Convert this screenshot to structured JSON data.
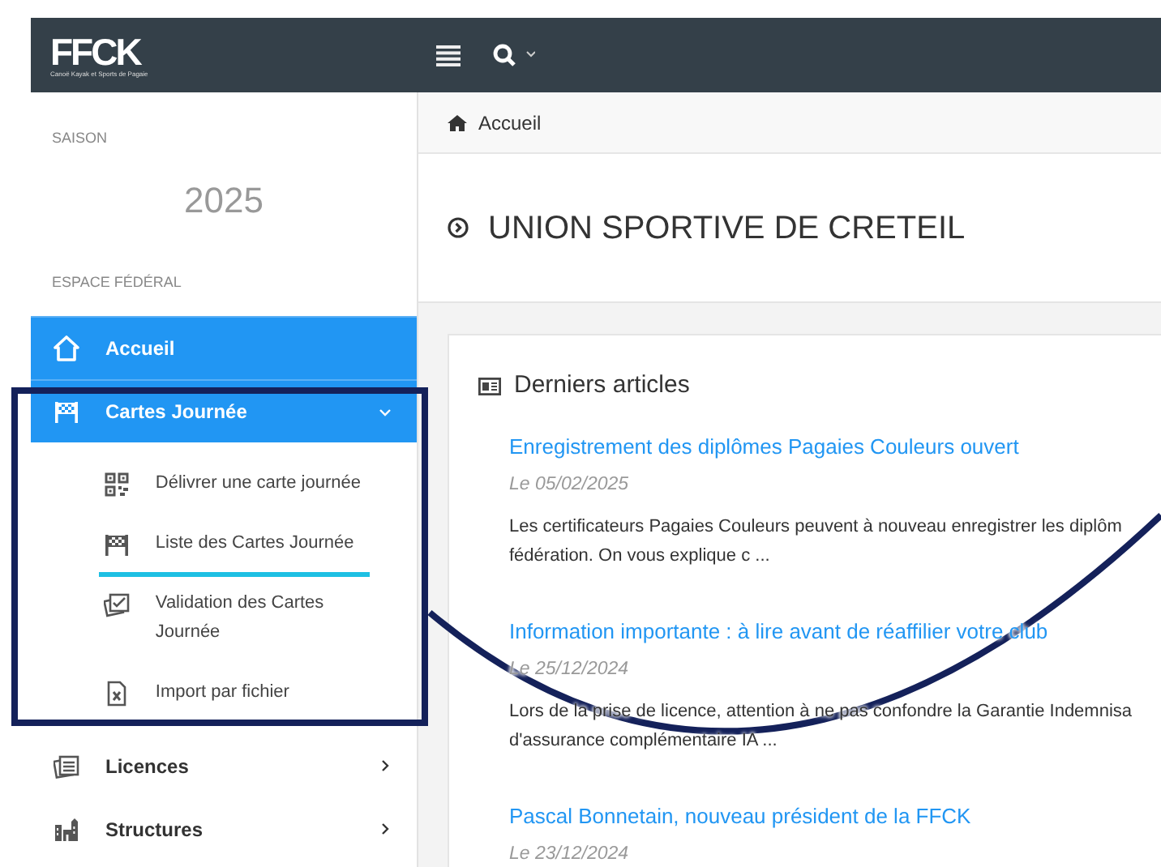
{
  "logo": {
    "text": "FFCK",
    "tagline": "Canoë Kayak et Sports de Pagaie"
  },
  "sidebar": {
    "season_label": "SAISON",
    "season": "2025",
    "section_label": "ESPACE FÉDÉRAL",
    "items": [
      {
        "label": "Accueil",
        "kind": "link",
        "active": true
      },
      {
        "label": "Cartes Journée",
        "kind": "group",
        "active": true,
        "expanded": true,
        "children": [
          {
            "label": "Délivrer une carte journée"
          },
          {
            "label": "Liste des Cartes Journée"
          },
          {
            "label": "Validation des Cartes Journée"
          },
          {
            "label": "Import par fichier"
          }
        ]
      },
      {
        "label": "Licences",
        "kind": "group",
        "active": false,
        "expanded": false
      },
      {
        "label": "Structures",
        "kind": "group",
        "active": false,
        "expanded": false
      }
    ]
  },
  "breadcrumb": "Accueil",
  "title": "UNION SPORTIVE DE CRETEIL",
  "articles_panel": {
    "title": "Derniers articles",
    "articles": [
      {
        "title": "Enregistrement des diplômes Pagaies Couleurs ouvert",
        "date": "Le 05/02/2025",
        "excerpt": "Les certificateurs Pagaies Couleurs peuvent à nouveau enregistrer les diplôm\nfédération. On vous explique c ..."
      },
      {
        "title": "Information importante : à lire avant de réaffilier votre club",
        "date": "Le 25/12/2024",
        "excerpt": "Lors de la prise de licence, attention à ne pas confondre la Garantie Indemnisa\nd'assurance complémentaire IA ..."
      },
      {
        "title": "Pascal Bonnetain, nouveau président de la FFCK",
        "date": "Le 23/12/2024"
      }
    ]
  },
  "annotations": [
    {
      "kind": "frame"
    },
    {
      "kind": "underline"
    },
    {
      "kind": "curve"
    }
  ]
}
